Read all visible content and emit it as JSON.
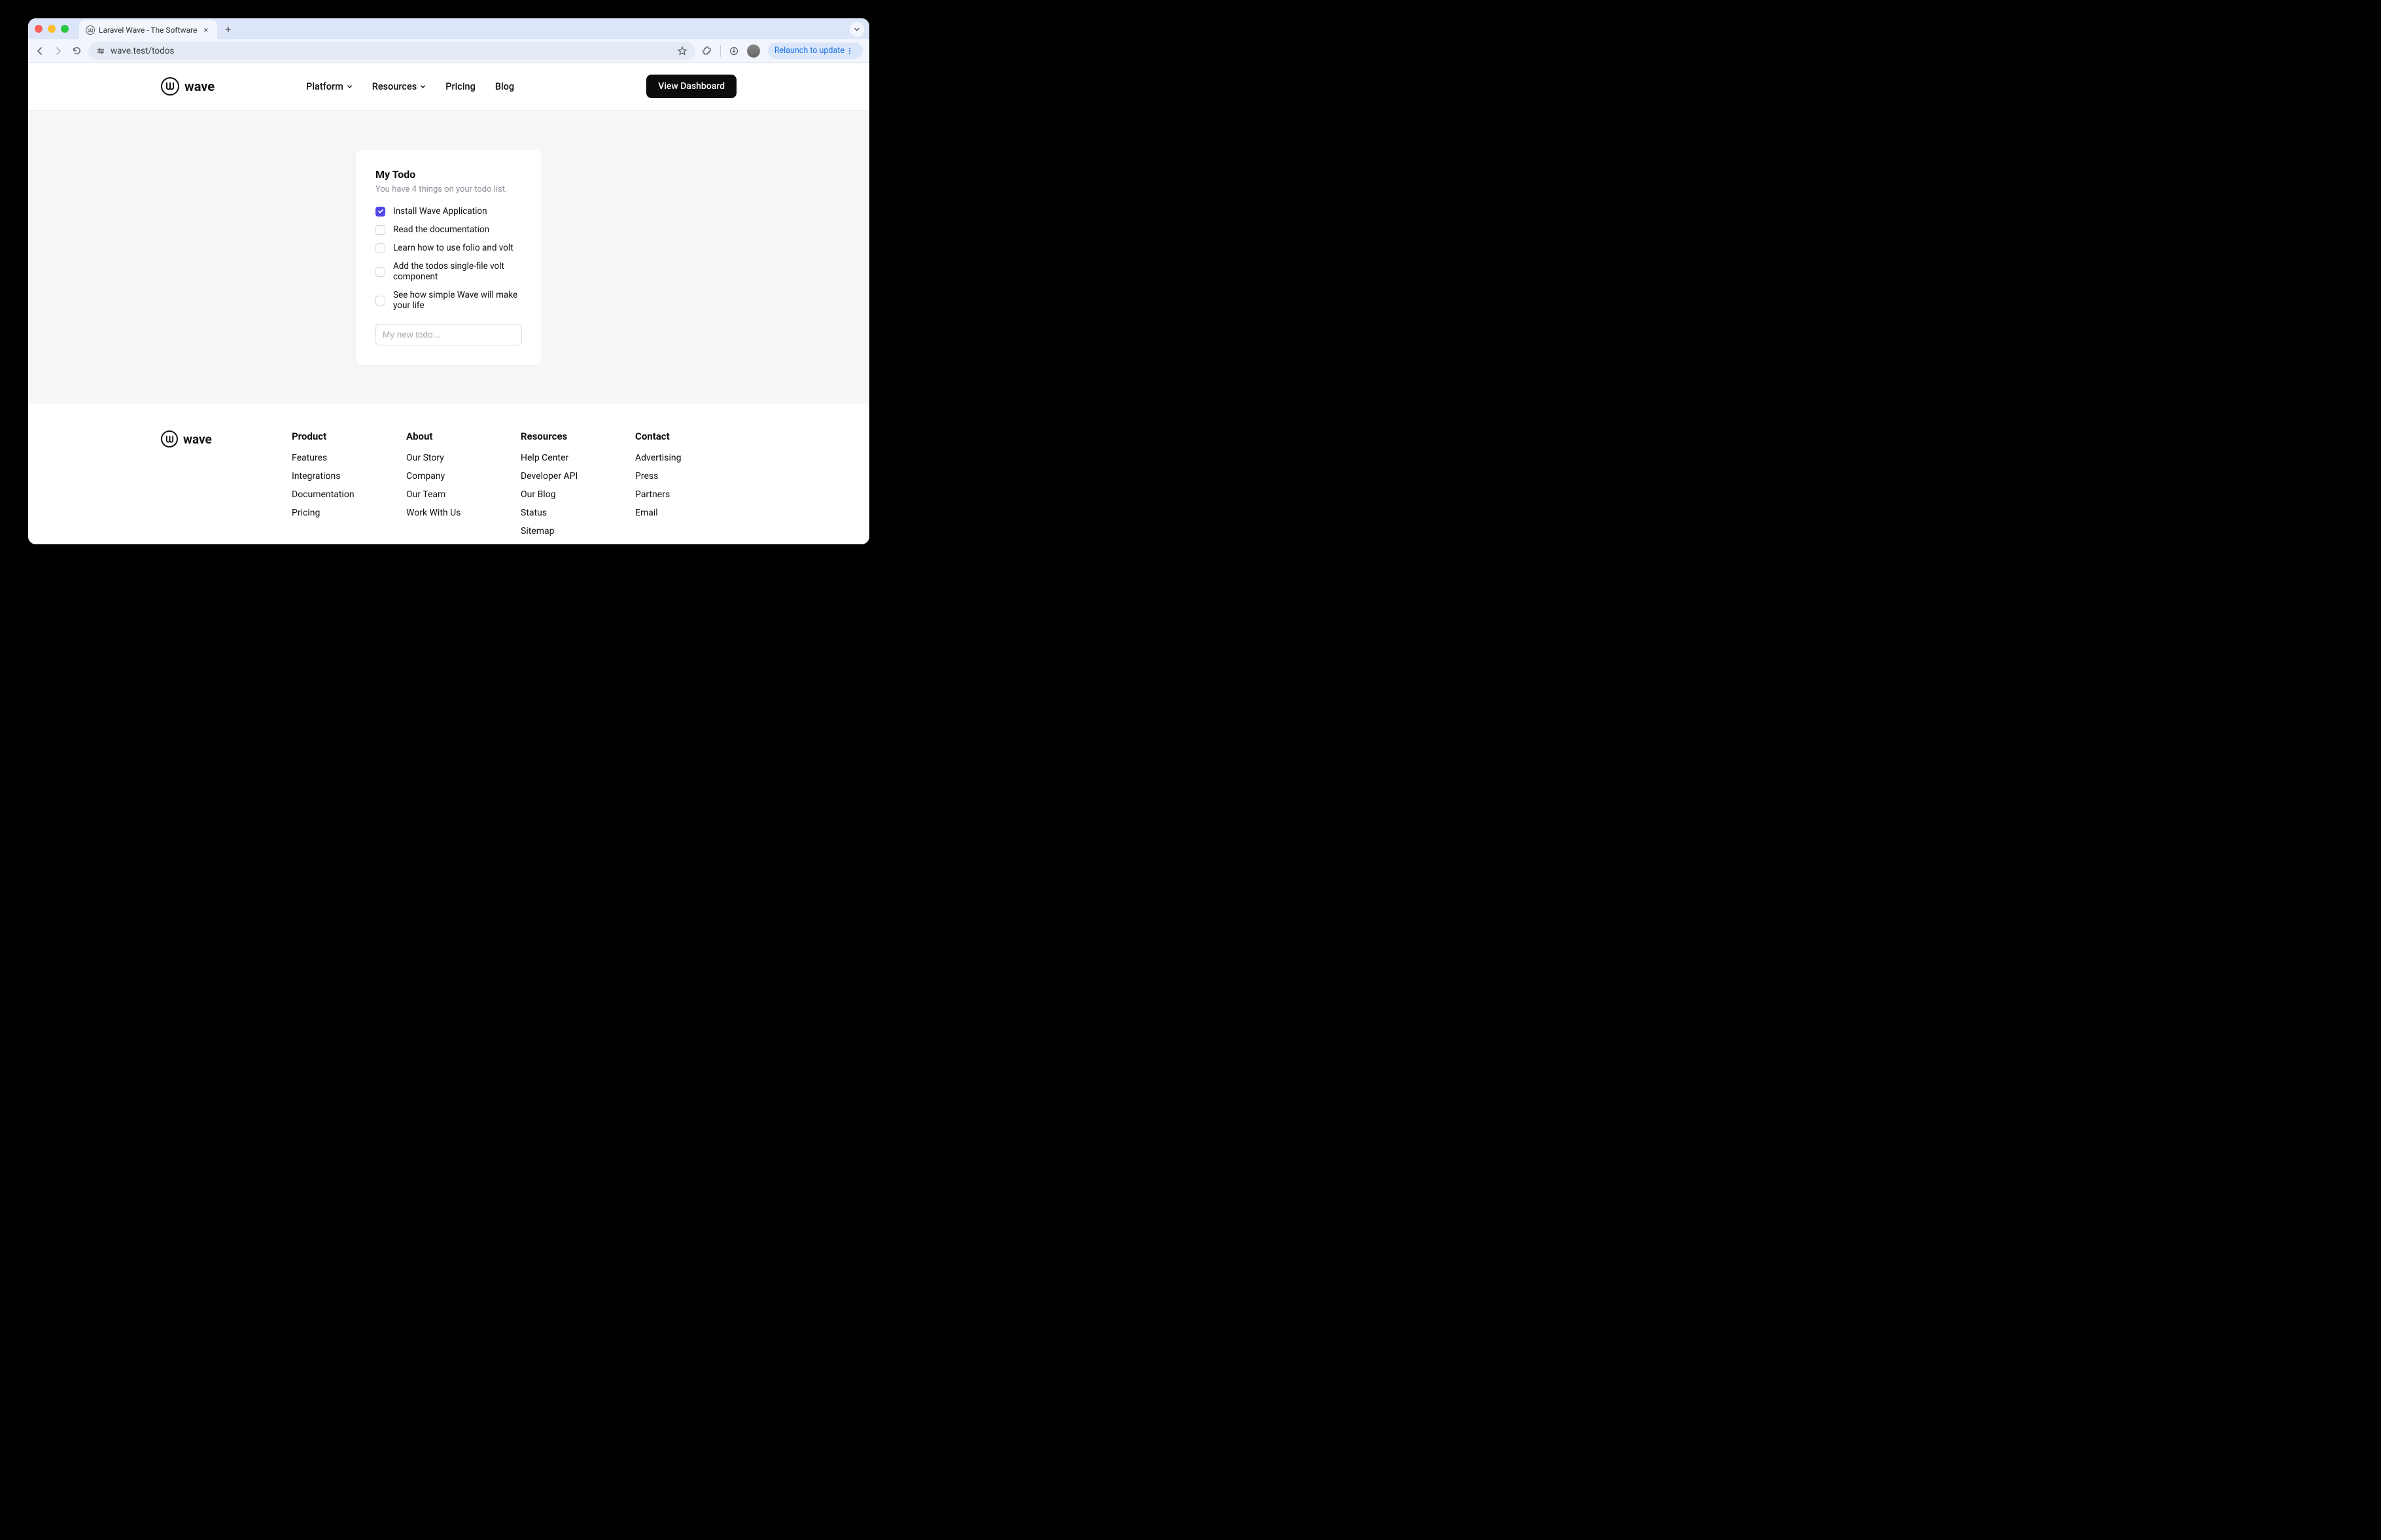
{
  "browser": {
    "tab_title": "Laravel Wave - The Software",
    "url": "wave.test/todos",
    "relaunch_label": "Relaunch to update"
  },
  "header": {
    "brand": "wave",
    "nav": {
      "platform": "Platform",
      "resources": "Resources",
      "pricing": "Pricing",
      "blog": "Blog"
    },
    "cta": "View Dashboard"
  },
  "card": {
    "title": "My Todo",
    "subtitle": "You have 4 things on your todo list.",
    "todos": [
      {
        "label": "Install Wave Application",
        "checked": true
      },
      {
        "label": "Read the documentation",
        "checked": false
      },
      {
        "label": "Learn how to use folio and volt",
        "checked": false
      },
      {
        "label": "Add the todos single-file volt component",
        "checked": false
      },
      {
        "label": "See how simple Wave will make your life",
        "checked": false
      }
    ],
    "input_placeholder": "My new todo..."
  },
  "footer": {
    "brand": "wave",
    "columns": [
      {
        "heading": "Product",
        "links": [
          "Features",
          "Integrations",
          "Documentation",
          "Pricing"
        ]
      },
      {
        "heading": "About",
        "links": [
          "Our Story",
          "Company",
          "Our Team",
          "Work With Us"
        ]
      },
      {
        "heading": "Resources",
        "links": [
          "Help Center",
          "Developer API",
          "Our Blog",
          "Status",
          "Sitemap"
        ]
      },
      {
        "heading": "Contact",
        "links": [
          "Advertising",
          "Press",
          "Partners",
          "Email"
        ]
      }
    ]
  }
}
